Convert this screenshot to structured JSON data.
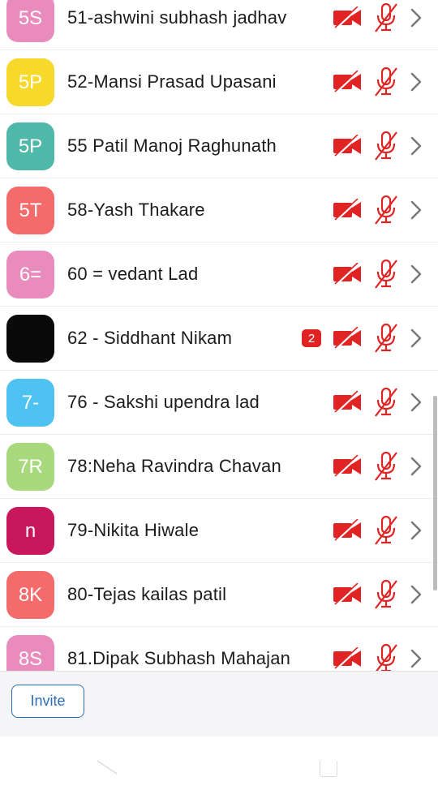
{
  "participants": [
    {
      "initials": "5S",
      "name": "51-ashwini subhash jadhav",
      "color": "#e98bbd",
      "badge": null
    },
    {
      "initials": "5P",
      "name": "52-Mansi Prasad Upasani",
      "color": "#f6d92a",
      "badge": null
    },
    {
      "initials": "5P",
      "name": "55 Patil Manoj Raghunath",
      "color": "#4fb8a8",
      "badge": null
    },
    {
      "initials": "5T",
      "name": "58-Yash Thakare",
      "color": "#f56a6a",
      "badge": null
    },
    {
      "initials": "6=",
      "name": "60 = vedant Lad",
      "color": "#e98bbd",
      "badge": null
    },
    {
      "initials": "",
      "name": "62 - Siddhant Nikam",
      "color": "#0a0a0a",
      "badge": "2"
    },
    {
      "initials": "7-",
      "name": "76 - Sakshi upendra lad",
      "color": "#4ec3f2",
      "badge": null
    },
    {
      "initials": "7R",
      "name": "78:Neha Ravindra Chavan",
      "color": "#a8d97d",
      "badge": null
    },
    {
      "initials": "n",
      "name": "79-Nikita Hiwale",
      "color": "#c8175c",
      "badge": null
    },
    {
      "initials": "8K",
      "name": "80-Tejas kailas patil",
      "color": "#f56a6a",
      "badge": null
    },
    {
      "initials": "8S",
      "name": "81.Dipak Subhash Mahajan",
      "color": "#e98bbd",
      "badge": null
    }
  ],
  "icons": {
    "video": "video-off-icon",
    "mic": "mic-off-icon",
    "chevron": "chevron-right-icon",
    "muted_color": "#e02424"
  },
  "footer": {
    "invite_label": "Invite"
  }
}
